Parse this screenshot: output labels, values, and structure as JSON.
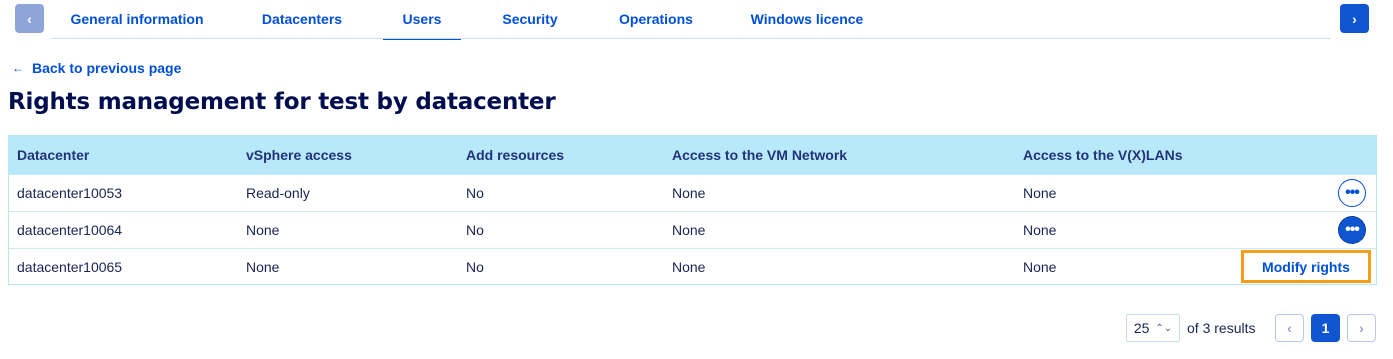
{
  "tabs": {
    "prev_icon": "‹",
    "next_icon": "›",
    "items": [
      {
        "label": "General information"
      },
      {
        "label": "Datacenters"
      },
      {
        "label": "Users"
      },
      {
        "label": "Security"
      },
      {
        "label": "Operations"
      },
      {
        "label": "Windows licence"
      }
    ],
    "active": "Users"
  },
  "back_link": {
    "arrow": "←",
    "label": "Back to previous page"
  },
  "page_title": "Rights management for test by datacenter",
  "table": {
    "columns": [
      "Datacenter",
      "vSphere access",
      "Add resources",
      "Access to the VM Network",
      "Access to the V(X)LANs"
    ],
    "rows": [
      [
        "datacenter10053",
        "Read-only",
        "No",
        "None",
        "None"
      ],
      [
        "datacenter10064",
        "None",
        "No",
        "None",
        "None"
      ],
      [
        "datacenter10065",
        "None",
        "No",
        "None",
        "None"
      ]
    ],
    "action_icon": "•••",
    "menu_item": "Modify rights"
  },
  "pagination": {
    "page_size": "25",
    "updown_icon": "⌃⌄",
    "results_text": "of 3 results",
    "prev_icon": "‹",
    "current_page": "1",
    "next_icon": "›"
  },
  "colors": {
    "accent": "#0050d7",
    "header_bg": "#b7e9fb",
    "highlight": "#f49f18"
  }
}
